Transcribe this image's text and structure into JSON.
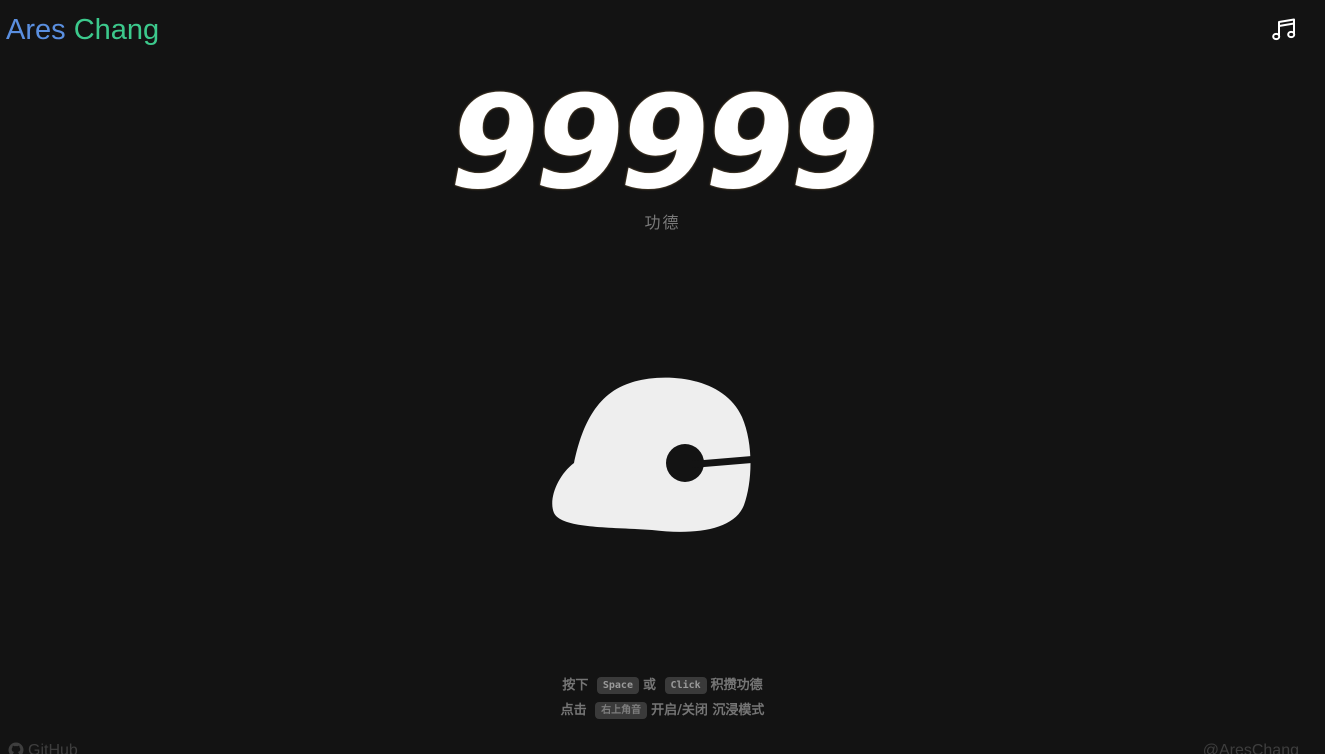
{
  "brand": {
    "first": "Ares",
    "last": "Chang"
  },
  "header": {
    "music_icon": "music-note-icon"
  },
  "counter": {
    "value": "99999",
    "label": "功德"
  },
  "woodfish": {
    "icon": "wooden-fish-icon",
    "color": "#eeeeee"
  },
  "hints": {
    "line1": {
      "prefix": "按下",
      "key1": "Space",
      "or": "或",
      "key2": "Click",
      "suffix": "积攒功德"
    },
    "line2": {
      "prefix": "点击",
      "key": "右上角音",
      "suffix": "开启/关闭 沉浸模式"
    }
  },
  "footer": {
    "github_label": "GitHub",
    "github_icon": "github-icon",
    "author": "@AresChang"
  },
  "colors": {
    "background": "#131313",
    "brand_blue": "#5a8fe0",
    "brand_green": "#3cc98c"
  }
}
